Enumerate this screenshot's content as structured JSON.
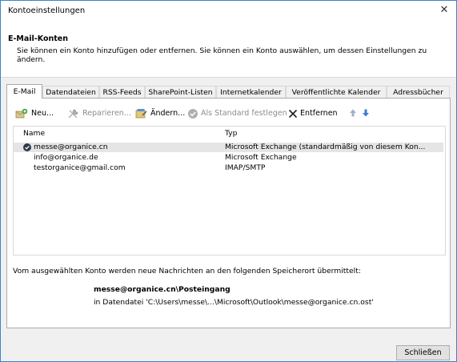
{
  "window": {
    "title": "Kontoeinstellungen"
  },
  "header": {
    "title": "E-Mail-Konten",
    "description": "Sie können ein Konto hinzufügen oder entfernen. Sie können ein Konto auswählen, um dessen Einstellungen zu ändern."
  },
  "tabs": [
    {
      "label": "E-Mail"
    },
    {
      "label": "Datendateien"
    },
    {
      "label": "RSS-Feeds"
    },
    {
      "label": "SharePoint-Listen"
    },
    {
      "label": "Internetkalender"
    },
    {
      "label": "Veröffentlichte Kalender"
    },
    {
      "label": "Adressbücher"
    }
  ],
  "toolbar": {
    "new_label": "Neu...",
    "repair_label": "Reparieren...",
    "change_label": "Ändern...",
    "default_label": "Als Standard festlegen",
    "remove_label": "Entfernen"
  },
  "accounts": {
    "col_name": "Name",
    "col_type": "Typ",
    "rows": [
      {
        "name": "messe@organice.cn",
        "type": "Microsoft Exchange (standardmäßig von diesem Kon..."
      },
      {
        "name": "info@organice.de",
        "type": "Microsoft Exchange"
      },
      {
        "name": "testorganice@gmail.com",
        "type": "IMAP/SMTP"
      }
    ]
  },
  "delivery": {
    "text": "Vom ausgewählten Konto werden neue Nachrichten an den folgenden Speicherort übermittelt:",
    "store": "messe@organice.cn\\Posteingang",
    "file": "in Datendatei 'C:\\Users\\messe\\...\\Microsoft\\Outlook\\messe@organice.cn.ost'"
  },
  "footer": {
    "close_label": "Schließen"
  },
  "colors": {
    "accent": "#3c84c8",
    "selected_row": "#e5e5e5",
    "disabled_text": "#8c8c8c"
  }
}
